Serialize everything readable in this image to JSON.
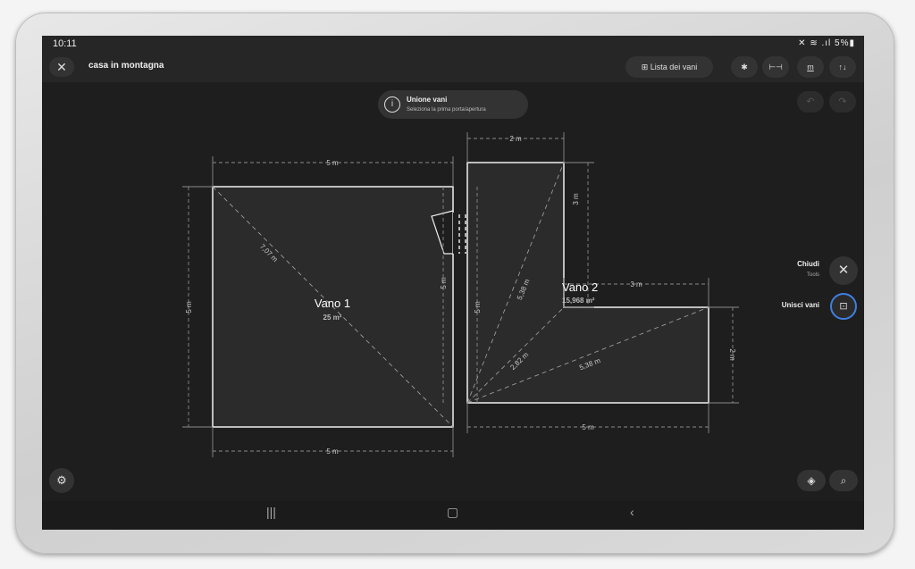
{
  "status": {
    "time": "10:11",
    "right": "✕ ≋ .ıl 5%▮"
  },
  "header": {
    "title": "casa in montagna",
    "rooms_list_label": "Lista dei vani",
    "bluetooth_icon": "bluetooth-icon",
    "ruler_label": "⊢⊣",
    "unit_label": "m",
    "sort_label": "↑↓"
  },
  "info": {
    "title": "Unione vani",
    "subtitle": "Seleziona la prima porta/apertura"
  },
  "rooms": [
    {
      "name": "Vano 1",
      "area": "25 m²"
    },
    {
      "name": "Vano 2",
      "area": "15,968 m²"
    }
  ],
  "dimensions": {
    "r1_top": "5 m",
    "r1_bottom": "5 m",
    "r1_left": "5 m",
    "r1_right": "5 m",
    "r1_diag": "7,07 m",
    "r2_top": "2 m",
    "r2_upper_right": "3 m",
    "r2_left": "5 m",
    "r2_step": "3 m",
    "r2_right": "2 m",
    "r2_bottom": "5 m",
    "r2_diag1": "5,38 m",
    "r2_diag2": "2,82 m",
    "r2_diag3": "5,38 m"
  },
  "tools": {
    "close_label": "Chiudi",
    "close_sub": "Tools",
    "merge_label": "Unisci vani"
  },
  "colors": {
    "accent": "#3f7fe0",
    "background": "#1e1e1e"
  }
}
